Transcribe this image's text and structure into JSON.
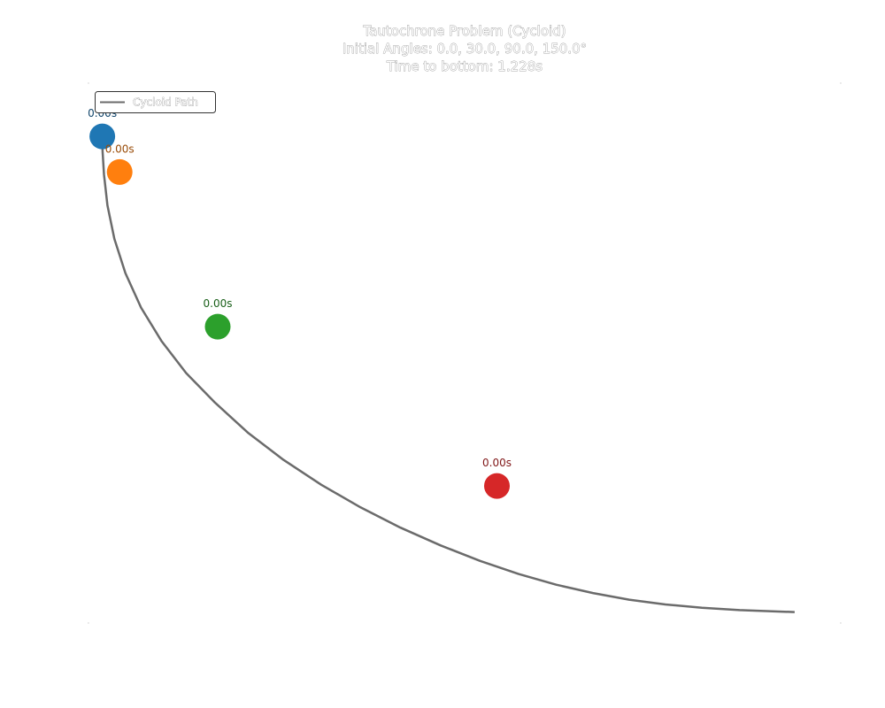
{
  "chart_data": {
    "type": "line",
    "title": [
      "Tautochrone Problem (Cycloid)",
      "Initial Angles: 0.0, 30.0, 90.0, 150.0°",
      "Time to bottom: 1.228s"
    ],
    "xlim": [
      -0.06,
      3.2
    ],
    "ylim": [
      -2.05,
      0.22
    ],
    "grid": false,
    "legend": {
      "position": "top-left",
      "entries": [
        "Cycloid Path"
      ]
    },
    "path": {
      "name": "Cycloid Path",
      "color": "#6b6b6b",
      "x": [
        0.0,
        0.001,
        0.007,
        0.022,
        0.052,
        0.1,
        0.168,
        0.256,
        0.363,
        0.489,
        0.63,
        0.785,
        0.949,
        1.119,
        1.292,
        1.466,
        1.637,
        1.804,
        1.967,
        2.126,
        2.283,
        2.44,
        2.599,
        2.762,
        2.93,
        3.0
      ],
      "y": [
        0.0,
        -0.062,
        -0.16,
        -0.29,
        -0.43,
        -0.575,
        -0.72,
        -0.86,
        -0.995,
        -1.12,
        -1.245,
        -1.36,
        -1.465,
        -1.56,
        -1.645,
        -1.72,
        -1.785,
        -1.84,
        -1.885,
        -1.92,
        -1.948,
        -1.968,
        -1.982,
        -1.992,
        -1.998,
        -2.0
      ]
    },
    "balls": [
      {
        "angle": 0.0,
        "x": 0.0,
        "y": 0.0,
        "label": "0.00s",
        "color": "#1f77b4"
      },
      {
        "angle": 30.0,
        "x": 0.075,
        "y": -0.15,
        "label": "0.00s",
        "color": "#ff7f0e"
      },
      {
        "angle": 90.0,
        "x": 0.5,
        "y": -0.8,
        "label": "0.00s",
        "color": "#2ca02c"
      },
      {
        "angle": 150.0,
        "x": 1.71,
        "y": -1.47,
        "label": "0.00s",
        "color": "#d62728"
      }
    ]
  }
}
